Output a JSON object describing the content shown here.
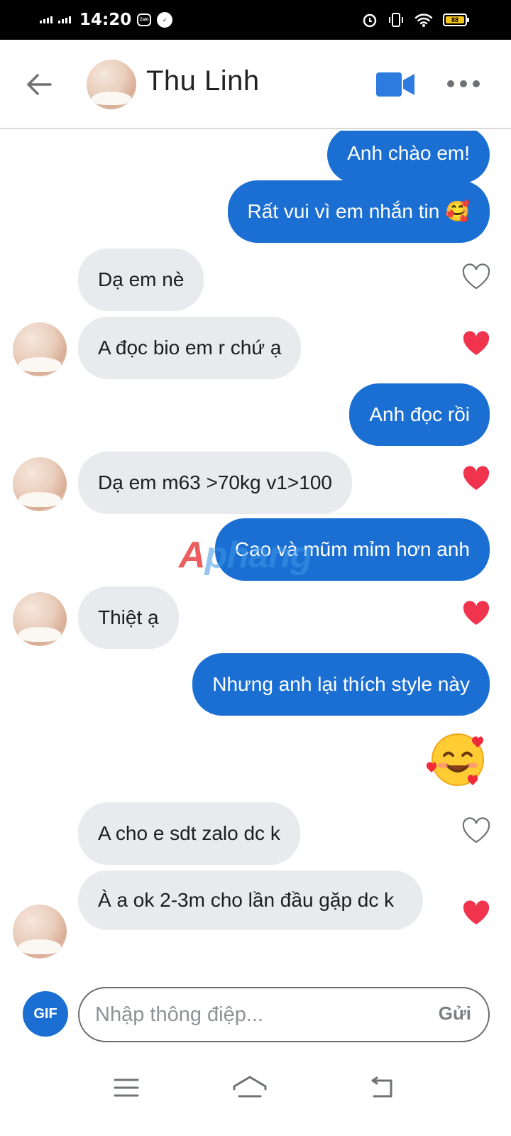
{
  "status_bar": {
    "time": "14:20",
    "zalo_icon_text": "Zalo",
    "battery": "88"
  },
  "header": {
    "contact_name": "Thu Linh",
    "icons": [
      "back-arrow-icon",
      "avatar",
      "video-call-icon",
      "more-icon"
    ]
  },
  "messages": [
    {
      "from": "me",
      "text": "Anh chào em!"
    },
    {
      "from": "me",
      "text": "Rất vui vì em nhắn tin 🥰"
    },
    {
      "from": "them",
      "text": "Dạ em nè",
      "liked": false
    },
    {
      "from": "them",
      "text": "A đọc bio em r chứ ạ",
      "liked": true
    },
    {
      "from": "me",
      "text": "Anh đọc rồi"
    },
    {
      "from": "them",
      "text": "Dạ em m63 >70kg v1>100",
      "liked": true
    },
    {
      "from": "me",
      "text": "Cao và mũm mỉm hơn anh"
    },
    {
      "from": "them",
      "text": "Thiệt ạ",
      "liked": true
    },
    {
      "from": "me",
      "text": "Nhưng anh lại thích style này"
    },
    {
      "from": "me",
      "text": "🥰"
    },
    {
      "from": "them",
      "text": "A cho e sdt zalo dc k",
      "liked": false
    },
    {
      "from": "them",
      "text": "À a ok 2-3m cho lần đầu gặp dc k",
      "liked": true
    }
  ],
  "watermark": {
    "first": "A",
    "rest": "phang"
  },
  "composer": {
    "gif_label": "GIF",
    "placeholder": "Nhập thông điệp...",
    "send_label": "Gửi"
  },
  "colors": {
    "accent": "#1b6fd2",
    "incoming_bubble": "#e9eaee",
    "heart_liked": "#f1344e"
  }
}
